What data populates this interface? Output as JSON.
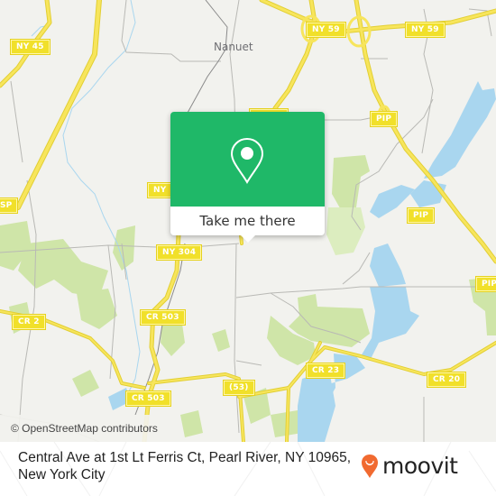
{
  "map": {
    "place_labels": [
      {
        "id": "nanuet",
        "text": "Nanuet"
      }
    ],
    "road_shields": [
      {
        "id": "ny45",
        "text": "NY 45"
      },
      {
        "id": "ny59-a",
        "text": "NY 59"
      },
      {
        "id": "ny59-b",
        "text": "NY 59"
      },
      {
        "id": "pip-a",
        "text": "PIP"
      },
      {
        "id": "pip-b",
        "text": "PIP"
      },
      {
        "id": "pip-c",
        "text": "PIP"
      },
      {
        "id": "ny-partial",
        "text": "NY"
      },
      {
        "id": "sp-partial",
        "text": "SP"
      },
      {
        "id": "ny304",
        "text": "NY 304"
      },
      {
        "id": "cr2",
        "text": "CR 2"
      },
      {
        "id": "cr503-a",
        "text": "CR 503"
      },
      {
        "id": "cr503-b",
        "text": "CR 503"
      },
      {
        "id": "rt53",
        "text": "(53)"
      },
      {
        "id": "cr23",
        "text": "CR 23"
      },
      {
        "id": "cr20",
        "text": "CR 20"
      },
      {
        "id": "ny-partial-top",
        "text": ""
      }
    ],
    "attribution": "© OpenStreetMap contributors",
    "colors": {
      "land": "#f2f2ee",
      "park": "#cfe5a8",
      "water": "#a9d6ef",
      "highway": "#f7e55c",
      "minor_road": "#b9b9b5"
    }
  },
  "popup": {
    "icon": "map-pin-icon",
    "button_label": "Take me there",
    "color": "#1fb868"
  },
  "footer": {
    "address_line1": "Central Ave at 1st Lt Ferris Ct, Pearl River, NY 10965,",
    "address_line2": "New York City",
    "brand": "moovit",
    "brand_icon": "moovit-pin-logo-icon",
    "brand_color": "#f16a30"
  }
}
